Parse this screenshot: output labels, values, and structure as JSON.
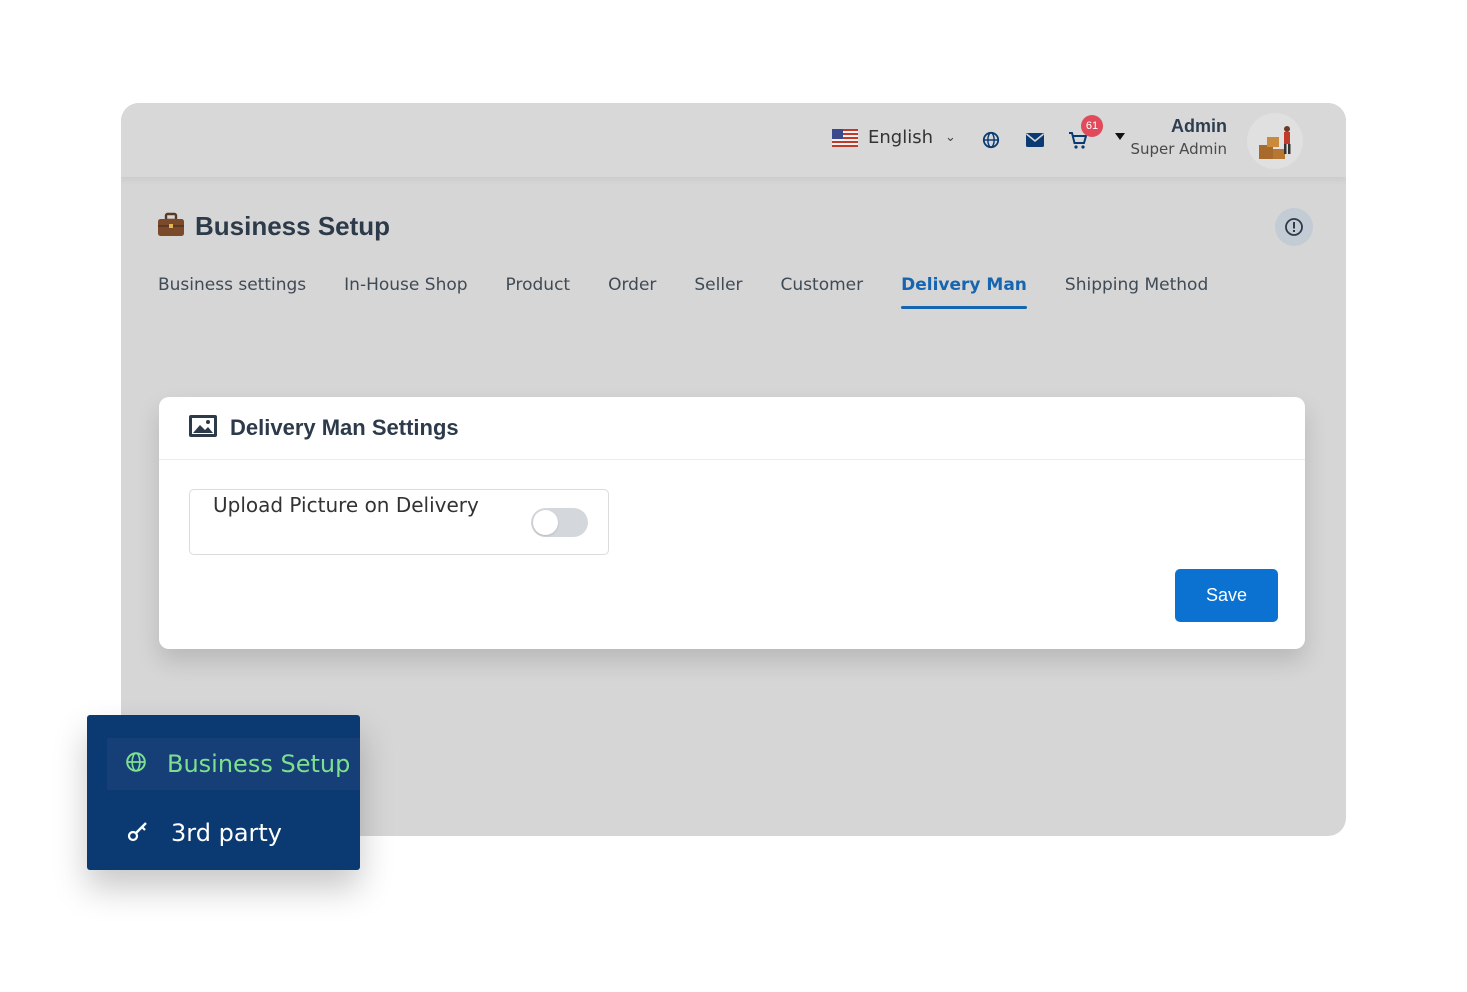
{
  "topbar": {
    "language": "English",
    "cart_count": "61",
    "user_name": "Admin",
    "user_role": "Super Admin",
    "icons": [
      "us-flag-icon",
      "globe-icon",
      "envelope-icon",
      "cart-icon",
      "caret-down-icon"
    ]
  },
  "page": {
    "title": "Business Setup",
    "title_icon": "briefcase-icon"
  },
  "tabs": [
    {
      "label": "Business settings",
      "active": false
    },
    {
      "label": "In-House Shop",
      "active": false
    },
    {
      "label": "Product",
      "active": false
    },
    {
      "label": "Order",
      "active": false
    },
    {
      "label": "Seller",
      "active": false
    },
    {
      "label": "Customer",
      "active": false
    },
    {
      "label": "Delivery Man",
      "active": true
    },
    {
      "label": "Shipping Method",
      "active": false
    }
  ],
  "card": {
    "title": "Delivery Man Settings",
    "setting_label": "Upload Picture on Delivery",
    "setting_enabled": false,
    "save_label": "Save"
  },
  "sidebar": {
    "items": [
      {
        "label": "Business Setup",
        "icon": "globe-icon",
        "active": true
      },
      {
        "label": "3rd party",
        "icon": "key-icon",
        "active": false
      }
    ]
  },
  "colors": {
    "accent": "#1565b0",
    "save_button": "#0b72d2",
    "sidebar_bg": "#0b3a73",
    "sidebar_active_text": "#7ee08f",
    "badge": "#e04a5a"
  }
}
